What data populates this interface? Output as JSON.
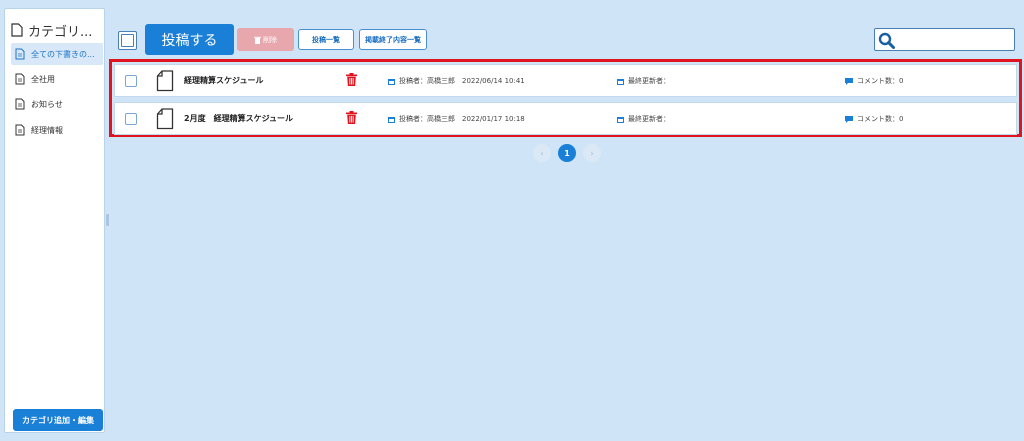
{
  "sidebar": {
    "header": "カテゴリ...",
    "items": [
      {
        "label": "全ての下書きの..."
      },
      {
        "label": "全社用"
      },
      {
        "label": "お知らせ"
      },
      {
        "label": "経理情報"
      }
    ],
    "edit_button": "カテゴリ追加・編集"
  },
  "toolbar": {
    "post_label": "投稿する",
    "delete_label": "削除",
    "post_list_label": "投稿一覧",
    "expired_list_label": "掲載終了内容一覧",
    "search_value": ""
  },
  "posts": [
    {
      "title": "経理精算スケジュール",
      "posted_by": "投稿者：高橋三郎　2022/06/14 10:41",
      "last_updated": "最終更新者：",
      "comments": "コメント数：0"
    },
    {
      "title": "2月度　経理精算スケジュール",
      "posted_by": "投稿者：高橋三郎　2022/01/17 10:18",
      "last_updated": "最終更新者：",
      "comments": "コメント数：0"
    }
  ],
  "pagination": {
    "prev": "‹",
    "current": "1",
    "next": "›"
  },
  "colors": {
    "background": "#cfe4f7",
    "primary": "#1a7fd6",
    "delete_disabled": "#e8a7ac",
    "highlight_frame": "#e0141e",
    "trash_icon": "#e0141e"
  }
}
